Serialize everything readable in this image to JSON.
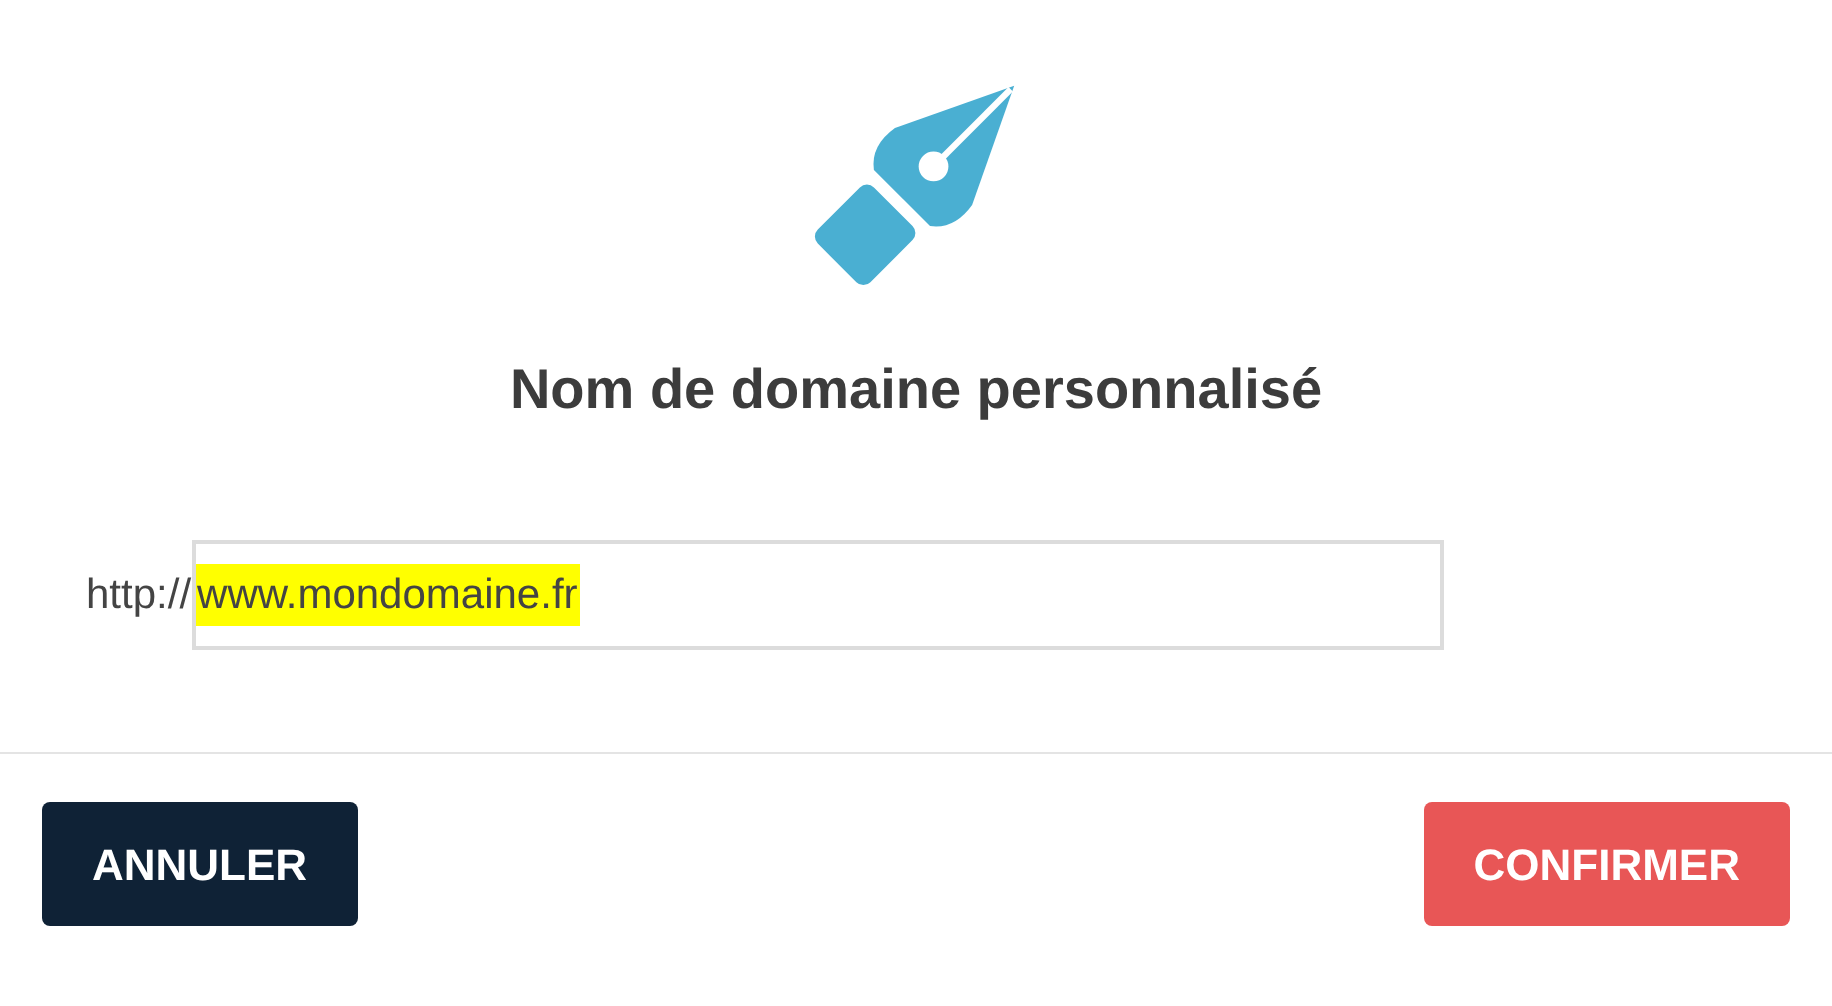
{
  "dialog": {
    "title": "Nom de domaine personnalisé",
    "url_field": {
      "prefix": "http://",
      "value": "www.mondomaine.fr",
      "selected": true
    },
    "buttons": [
      {
        "kind": "secondary",
        "label": "ANNULER"
      },
      {
        "kind": "primary",
        "label": "CONFIRMER"
      }
    ]
  }
}
